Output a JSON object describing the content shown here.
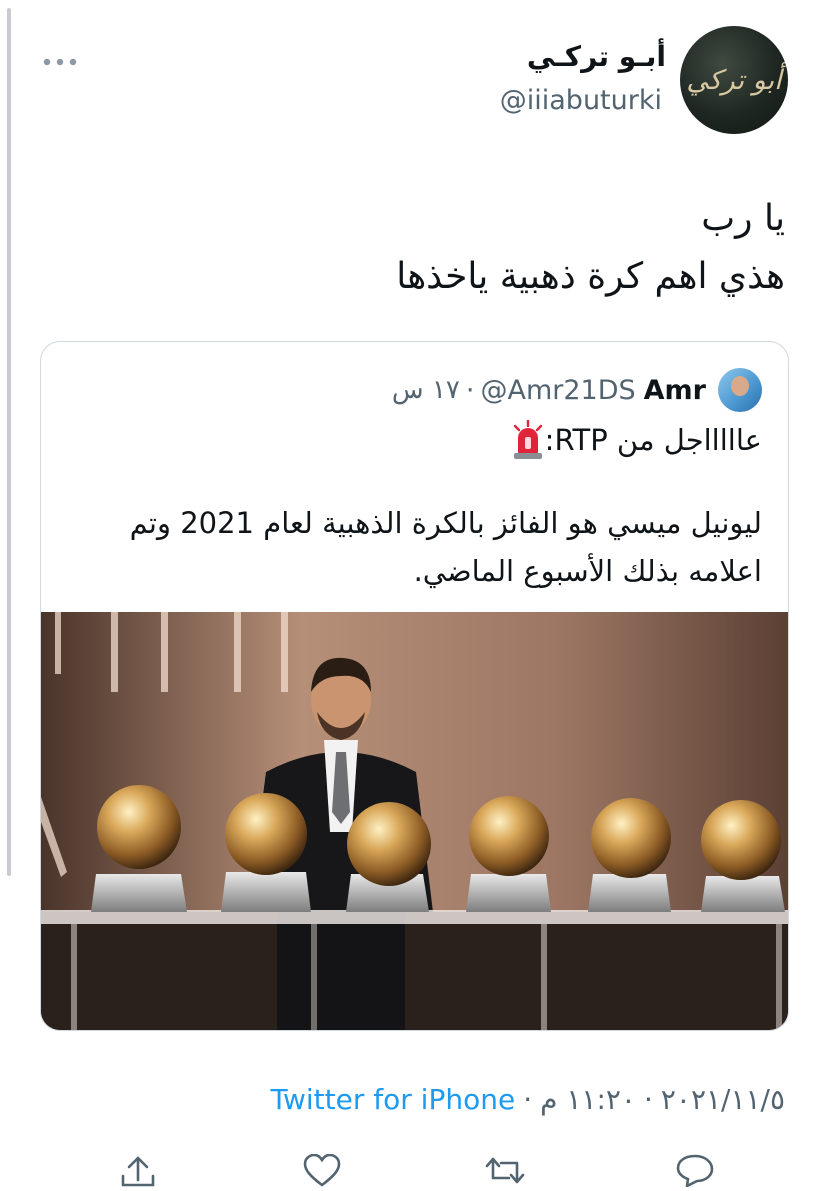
{
  "tweet": {
    "display_name": "أبـو تركـي",
    "handle": "@iiiabuturki",
    "avatar_text": "أبو تركي",
    "text_line1": "يا رب",
    "text_line2": "هذي اهم كرة ذهبية ياخذها"
  },
  "quoted_tweet": {
    "name": "Amr",
    "handle": "@Amr21DS",
    "separator": "·",
    "time": "١٧ س",
    "alert_icon": "siren-emoji",
    "alert_text": "عاااااجل من RTP:",
    "body": "ليونيل ميسي هو الفائز بالكرة الذهبية لعام 2021 وتم اعلامه بذلك الأسبوع الماضي."
  },
  "meta": {
    "date": "٢٠٢١/١١/٥",
    "time": "١١:٢٠ م",
    "separator": "·",
    "source": "Twitter for iPhone"
  },
  "actions": [
    "share-icon",
    "like-icon",
    "retweet-icon",
    "reply-icon"
  ],
  "colors": {
    "link": "#1d9bf0",
    "secondary_text": "#536471",
    "primary_text": "#0f1419",
    "border": "#cfd9de"
  }
}
